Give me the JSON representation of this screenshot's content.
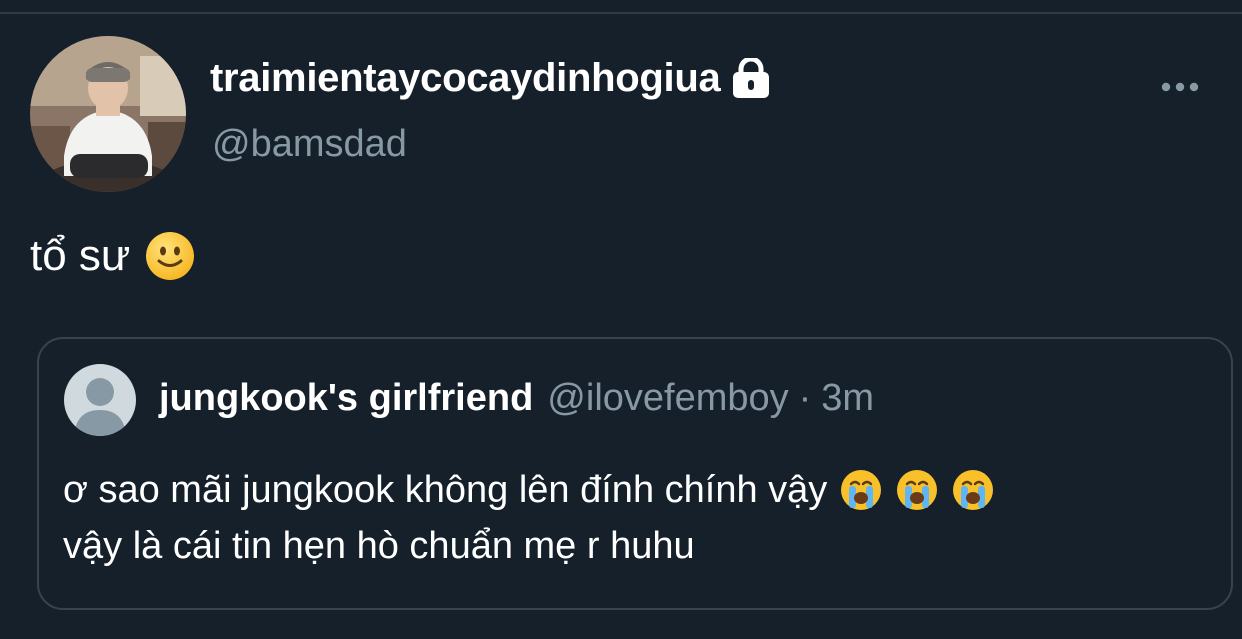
{
  "tweet": {
    "author": {
      "display_name": "traimientaycocaydinhogiua",
      "handle": "@bamsdad",
      "protected_icon": "lock-icon",
      "avatar_icon": "profile-photo"
    },
    "text": "tổ sư",
    "text_emoji": "slightly-smiling-face-emoji",
    "menu_icon": "more-horizontal-icon"
  },
  "quote": {
    "author": {
      "display_name": "jungkook's girlfriend",
      "handle": "@ilovefemboy",
      "avatar_icon": "default-avatar"
    },
    "separator": "·",
    "time": "3m",
    "line1": "ơ sao mãi jungkook không lên đính chính vậy",
    "line1_emojis": [
      "loudly-crying-face-emoji",
      "loudly-crying-face-emoji",
      "loudly-crying-face-emoji"
    ],
    "line2": "vậy là cái tin hẹn hò chuẩn mẹ r huhu"
  },
  "colors": {
    "background": "#15202b",
    "primary_text": "#ffffff",
    "secondary_text": "#8899a6",
    "border": "#38444d"
  }
}
